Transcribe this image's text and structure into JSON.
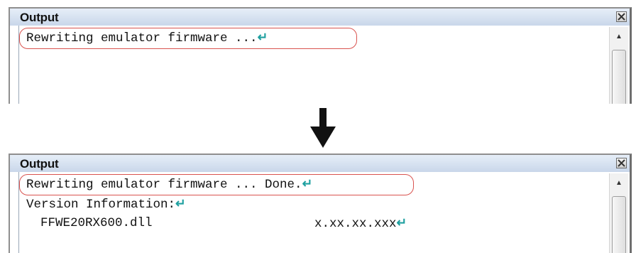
{
  "before": {
    "title": "Output",
    "line1": "Rewriting emulator firmware ..."
  },
  "after": {
    "title": "Output",
    "line1": "Rewriting emulator firmware ... Done.",
    "line2": "Version Information:",
    "line3_name": "FFWE20RX600.dll",
    "line3_version": "x.xx.xx.xxx"
  },
  "icons": {
    "close": "close-icon",
    "scroll_up": "scroll-up-icon",
    "return_mark": "return-mark-icon",
    "transition_arrow": "down-arrow-icon"
  },
  "colors": {
    "highlight": "#d9534f",
    "return_mark": "#1fa0a0"
  }
}
